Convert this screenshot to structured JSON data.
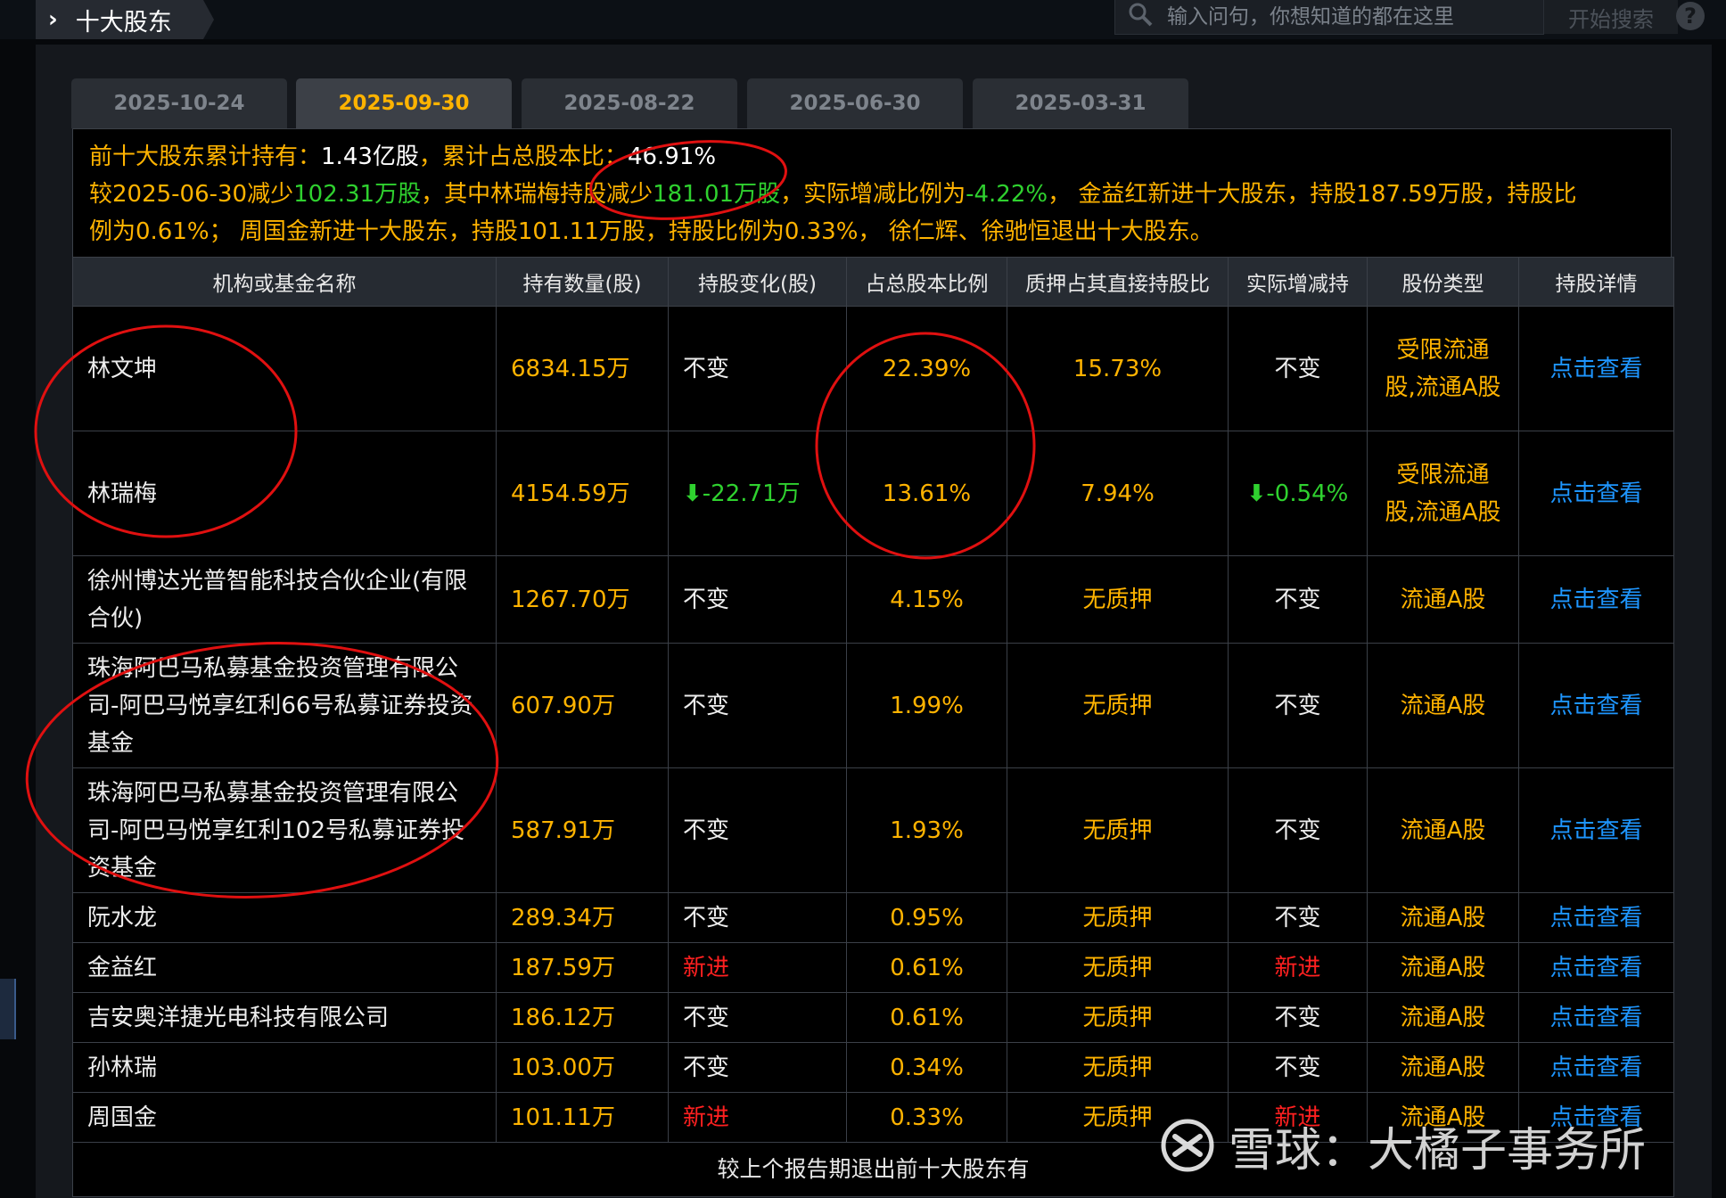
{
  "header": {
    "title": "十大股东",
    "search_placeholder": "输入问句，你想知道的都在这里",
    "search_button": "开始搜索",
    "help": "?"
  },
  "tabs": [
    {
      "label": "2025-10-24",
      "active": false
    },
    {
      "label": "2025-09-30",
      "active": true
    },
    {
      "label": "2025-08-22",
      "active": false
    },
    {
      "label": "2025-06-30",
      "active": false
    },
    {
      "label": "2025-03-31",
      "active": false
    }
  ],
  "summary": {
    "l1a": "前十大股东累计持有：",
    "l1b": "1.43亿股",
    "l1c": "，累计占总股本比：",
    "l1d": "46.91%",
    "l2a": "较2025-06-30减少",
    "l2b": "102.31万股",
    "l2c": "，其中林瑞梅持股减少",
    "l2d": "181.01万股",
    "l2e": "，实际增减比例为",
    "l2f": "-4.22%",
    "l2g": "， 金益红新进十大股东，持股187.59万股，持股比",
    "l3": "例为0.61%； 周国金新进十大股东，持股101.11万股，持股比例为0.33%， 徐仁辉、徐驰恒退出十大股东。"
  },
  "table": {
    "headers": [
      "机构或基金名称",
      "持有数量(股)",
      "持股变化(股)",
      "占总股本比例",
      "质押占其直接持股比",
      "实际增减持",
      "股份类型",
      "持股详情"
    ],
    "rows": [
      {
        "name": "林文坤",
        "qty": "6834.15万",
        "chg": "不变",
        "ratio": "22.39%",
        "pledge": "15.73%",
        "act": "不变",
        "type": "受限流通股,流通A股",
        "detail": "点击查看"
      },
      {
        "name": "林瑞梅",
        "qty": "4154.59万",
        "chg": "-22.71万",
        "ratio": "13.61%",
        "pledge": "7.94%",
        "act": "-0.54%",
        "type": "受限流通股,流通A股",
        "detail": "点击查看"
      },
      {
        "name": "徐州博达光普智能科技合伙企业(有限合伙)",
        "qty": "1267.70万",
        "chg": "不变",
        "ratio": "4.15%",
        "pledge": "无质押",
        "act": "不变",
        "type": "流通A股",
        "detail": "点击查看"
      },
      {
        "name": "珠海阿巴马私募基金投资管理有限公司-阿巴马悦享红利66号私募证券投资基金",
        "qty": "607.90万",
        "chg": "不变",
        "ratio": "1.99%",
        "pledge": "无质押",
        "act": "不变",
        "type": "流通A股",
        "detail": "点击查看"
      },
      {
        "name": "珠海阿巴马私募基金投资管理有限公司-阿巴马悦享红利102号私募证券投资基金",
        "qty": "587.91万",
        "chg": "不变",
        "ratio": "1.93%",
        "pledge": "无质押",
        "act": "不变",
        "type": "流通A股",
        "detail": "点击查看"
      },
      {
        "name": "阮水龙",
        "qty": "289.34万",
        "chg": "不变",
        "ratio": "0.95%",
        "pledge": "无质押",
        "act": "不变",
        "type": "流通A股",
        "detail": "点击查看"
      },
      {
        "name": "金益红",
        "qty": "187.59万",
        "chg": "新进",
        "ratio": "0.61%",
        "pledge": "无质押",
        "act": "新进",
        "type": "流通A股",
        "detail": "点击查看"
      },
      {
        "name": "吉安奥洋捷光电科技有限公司",
        "qty": "186.12万",
        "chg": "不变",
        "ratio": "0.61%",
        "pledge": "无质押",
        "act": "不变",
        "type": "流通A股",
        "detail": "点击查看"
      },
      {
        "name": "孙林瑞",
        "qty": "103.00万",
        "chg": "不变",
        "ratio": "0.34%",
        "pledge": "无质押",
        "act": "不变",
        "type": "流通A股",
        "detail": "点击查看"
      },
      {
        "name": "周国金",
        "qty": "101.11万",
        "chg": "新进",
        "ratio": "0.33%",
        "pledge": "无质押",
        "act": "新进",
        "type": "流通A股",
        "detail": "点击查看"
      }
    ],
    "footer": "较上个报告期退出前十大股东有"
  },
  "watermark": {
    "text": "雪球：大橘子事务所"
  },
  "colors": {
    "accent": "#ffb300",
    "up_new": "#ff2020",
    "down": "#2fd12f",
    "link": "#1e96ff",
    "annotation": "#e01010"
  }
}
